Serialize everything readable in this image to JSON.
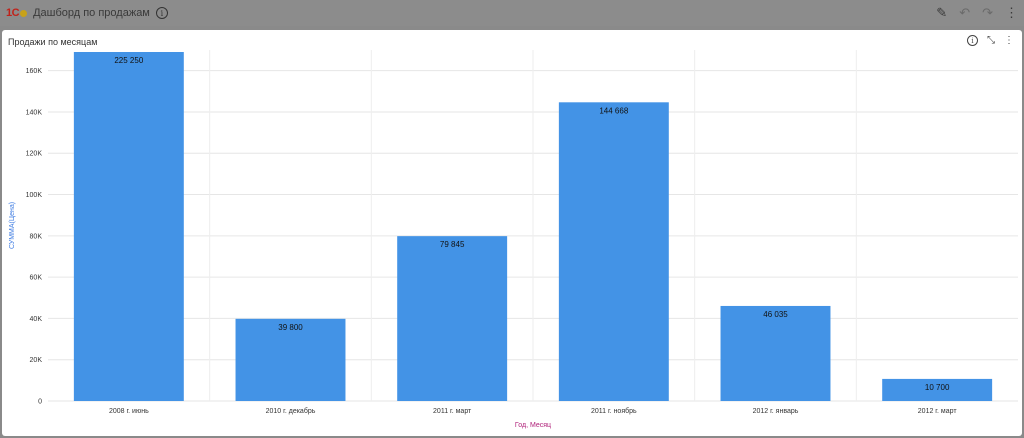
{
  "app": {
    "logo_text": "1C",
    "title": "Дашборд по продажам",
    "info_icon": "info-icon",
    "actions": [
      "edit-icon",
      "undo-icon",
      "redo-icon",
      "more-vert-icon"
    ]
  },
  "panel": {
    "title": "Продажи по месяцам",
    "actions": [
      "info-icon",
      "collapse-icon",
      "more-vert-icon"
    ]
  },
  "colors": {
    "bar": "#4393e6",
    "y_label": "#3d7be2",
    "x_label": "#b0227a"
  },
  "chart_data": {
    "type": "bar",
    "title": "Продажи по месяцам",
    "xlabel": "Год, Месяц",
    "ylabel": "СУММА(Цена)",
    "ylim": [
      0,
      170000
    ],
    "yticks": [
      0,
      20000,
      40000,
      60000,
      80000,
      100000,
      120000,
      140000,
      160000
    ],
    "ytick_labels": [
      "0",
      "20K",
      "40K",
      "60K",
      "80K",
      "100K",
      "120K",
      "140K",
      "160K"
    ],
    "categories": [
      "2008 г. июнь",
      "2010 г. декабрь",
      "2011 г. март",
      "2011 г. ноябрь",
      "2012 г. январь",
      "2012 г. март"
    ],
    "values": [
      225250,
      39800,
      79845,
      144668,
      46035,
      10700
    ],
    "data_labels": [
      "225 250",
      "39 800",
      "79 845",
      "144 668",
      "46 035",
      "10 700"
    ],
    "grid": true,
    "legend": "none"
  }
}
